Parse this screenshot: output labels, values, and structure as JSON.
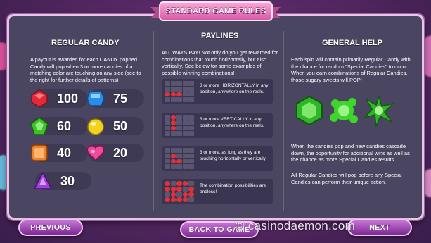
{
  "title": "STANDARD GAME RULES",
  "regular_candy": {
    "heading": "REGULAR CANDY",
    "description": "A payout is awarded for each CANDY popped. Candy will pop when 3 or more candies of a matching color are touching on any side (see to the right for further details of patterns)",
    "items": [
      {
        "icon": "red-candy-icon",
        "color": "#e02a3a",
        "value": "100"
      },
      {
        "icon": "blue-candy-icon",
        "color": "#2a8ee8",
        "value": "75"
      },
      {
        "icon": "green-candy-icon",
        "color": "#3fbf2a",
        "value": "60"
      },
      {
        "icon": "yellow-candy-icon",
        "color": "#f2d21e",
        "value": "50"
      },
      {
        "icon": "orange-candy-icon",
        "color": "#f0822a",
        "value": "40"
      },
      {
        "icon": "pink-heart-candy-icon",
        "color": "#f04a9a",
        "value": "20"
      },
      {
        "icon": "purple-triangle-candy-icon",
        "color": "#a23fd6",
        "value": "30"
      }
    ]
  },
  "paylines": {
    "heading": "PAYLINES",
    "description": "ALL WAYS PAY! Not only do you get rewarded for combinations that touch horizontally, but also vertically. See below for some examples of possible winning combinations!",
    "rows": [
      {
        "text": "3 or more HORIZONTALLY in any position, anywhere on the reels."
      },
      {
        "text": "3 or more VERTICALLY in any position, anywhere on the reels."
      },
      {
        "text": "3 or more, as long as they are touching horizontally or vertically."
      },
      {
        "text": "The combination possibilities are endless!"
      }
    ]
  },
  "general_help": {
    "heading": "GENERAL HELP",
    "paragraph1": "Each spin will contain primarily Regular Candy with the chance for random \"Special Candies\" to occur. When you earn combinations of Regular Candies, those sugary sweets will POP!",
    "paragraph2": "When the candies pop and new candies cascade down, the opportunity for additional wins as well as the chance as more Special Candies results.",
    "paragraph3": "All Regular Candies will pop before any Special Candies can perform their unique action."
  },
  "buttons": {
    "previous": "PREVIOUS",
    "back": "BACK TO GAME",
    "next": "NEXT"
  },
  "watermark": "© casinodaemon.com"
}
